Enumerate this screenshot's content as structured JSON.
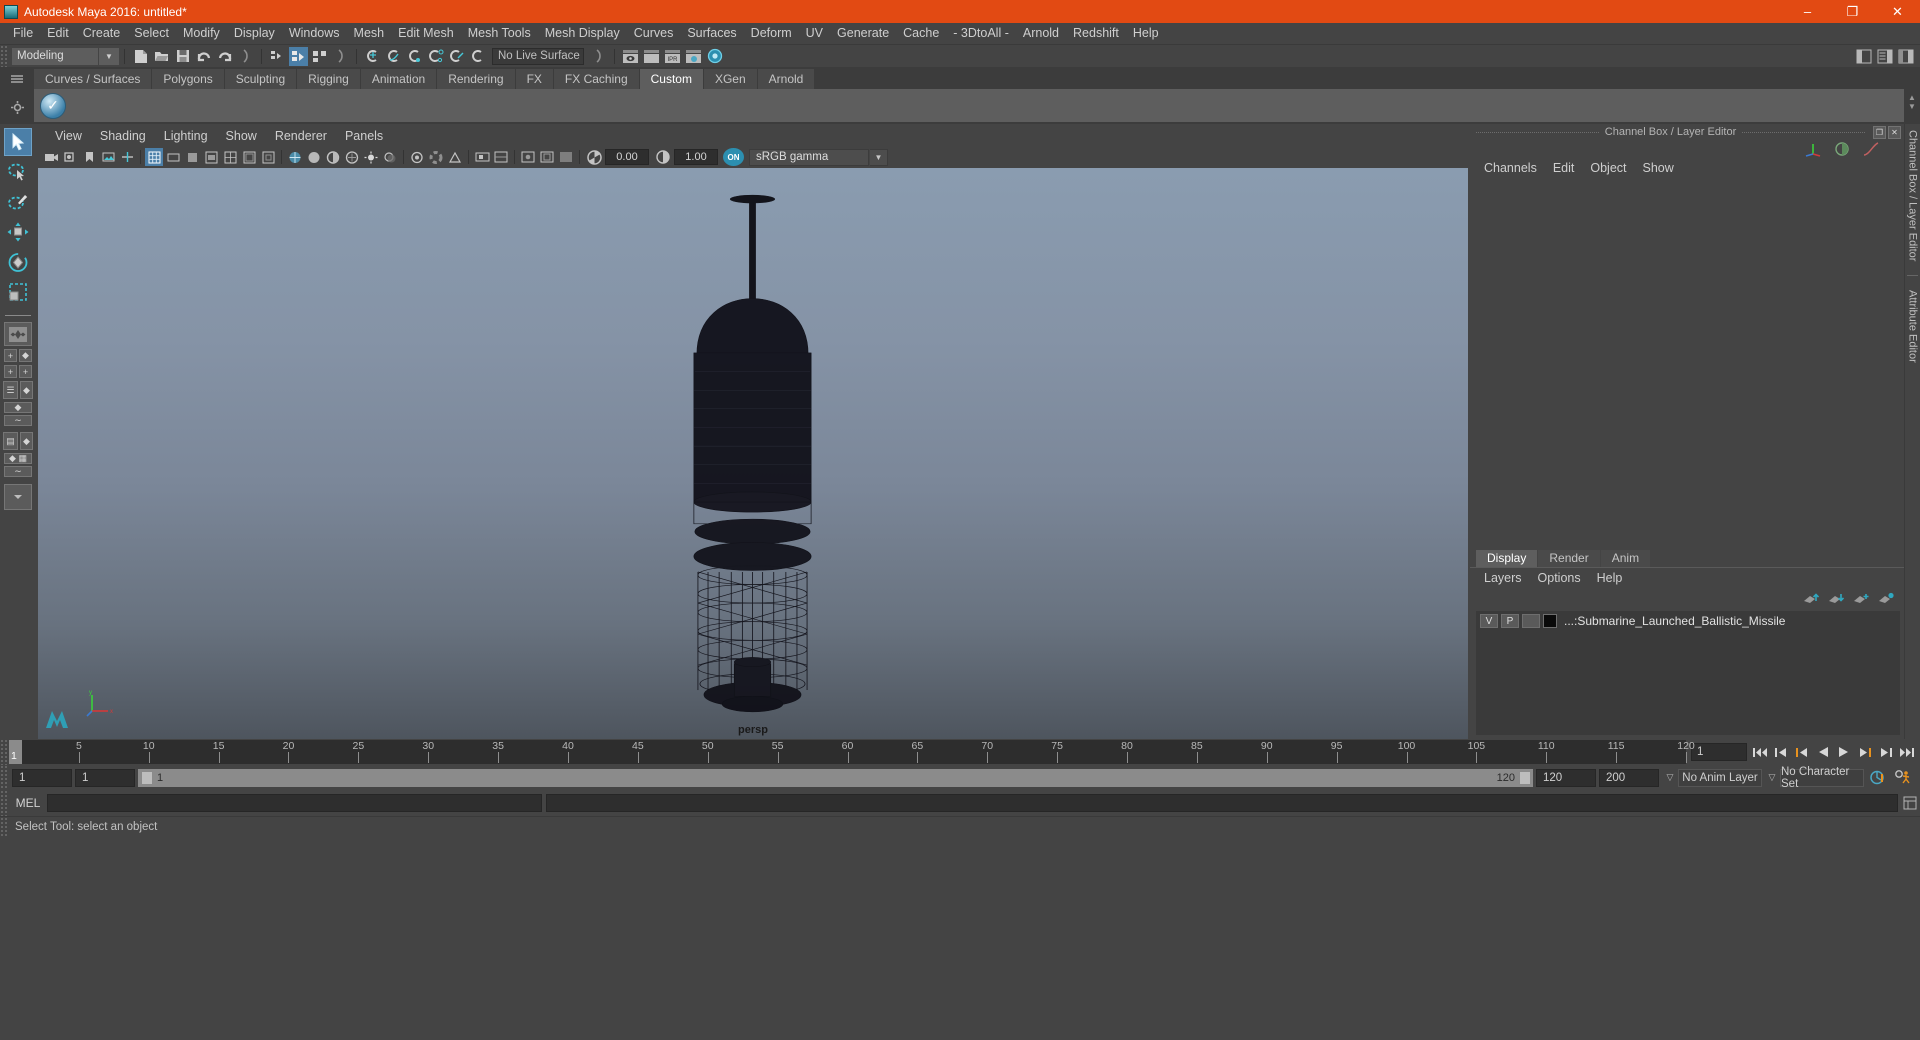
{
  "window": {
    "title": "Autodesk Maya 2016: untitled*",
    "minimize": "–",
    "maximize": "❐",
    "close": "✕"
  },
  "menubar": {
    "items": [
      "File",
      "Edit",
      "Create",
      "Select",
      "Modify",
      "Display",
      "Windows",
      "Mesh",
      "Edit Mesh",
      "Mesh Tools",
      "Mesh Display",
      "Curves",
      "Surfaces",
      "Deform",
      "UV",
      "Generate",
      "Cache",
      "- 3DtoAll -",
      "Arnold",
      "Redshift",
      "Help"
    ]
  },
  "statusbar": {
    "mode": "Modeling",
    "mode_arrow": "▼",
    "live_surface": "No Live Surface"
  },
  "shelf": {
    "tabs": [
      "Curves / Surfaces",
      "Polygons",
      "Sculpting",
      "Rigging",
      "Animation",
      "Rendering",
      "FX",
      "FX Caching",
      "Custom",
      "XGen",
      "Arnold"
    ],
    "active_tab": "Custom",
    "rail_up": "▲",
    "rail_down": "▼"
  },
  "viewport": {
    "menus": [
      "View",
      "Shading",
      "Lighting",
      "Show",
      "Renderer",
      "Panels"
    ],
    "exposure": "0.00",
    "gamma": "1.00",
    "color_mgmt_toggle": "ON",
    "color_profile": "sRGB gamma",
    "profile_arrow": "▼",
    "camera_label": "persp",
    "axis": {
      "x": "x",
      "y": "y",
      "z": "z"
    }
  },
  "channel_box": {
    "panel_title": "Channel Box / Layer Editor",
    "undock": "❐",
    "close": "✕",
    "menus": [
      "Channels",
      "Edit",
      "Object",
      "Show"
    ],
    "vertical_tabs": [
      "Channel Box / Layer Editor",
      "Attribute Editor"
    ]
  },
  "layer_editor": {
    "tabs": [
      "Display",
      "Render",
      "Anim"
    ],
    "active_tab": "Display",
    "menus": [
      "Layers",
      "Options",
      "Help"
    ],
    "layers": [
      {
        "visibility": "V",
        "playback": "P",
        "shading": "",
        "color": "#0a0a0a",
        "name": "...:Submarine_Launched_Ballistic_Missile"
      }
    ]
  },
  "timeline": {
    "current_frame": "1",
    "ticks": [
      5,
      10,
      15,
      20,
      25,
      30,
      35,
      40,
      45,
      50,
      55,
      60,
      65,
      70,
      75,
      80,
      85,
      90,
      95,
      100,
      105,
      110,
      115,
      120
    ],
    "frame_field": "1",
    "playback_buttons": [
      "❘◀◀",
      "❘◀",
      "❘◀",
      "◀",
      "▶",
      "▶❘",
      "▶❘",
      "▶▶❘"
    ]
  },
  "range": {
    "start": "1",
    "end": "1",
    "range_start_label": "1",
    "range_end_label": "120",
    "anim_end": "120",
    "playback_end": "200",
    "anim_layer": "No Anim Layer",
    "character_set": "No Character Set",
    "arrow": "▽"
  },
  "command_line": {
    "label": "MEL",
    "input": "",
    "output": ""
  },
  "status": {
    "help_text": "Select Tool: select an object"
  },
  "colors": {
    "title_orange": "#e24a13",
    "accent_blue": "#4b7fa8",
    "panel_gray": "#444444",
    "shelf_gray": "#5e5e5e"
  }
}
